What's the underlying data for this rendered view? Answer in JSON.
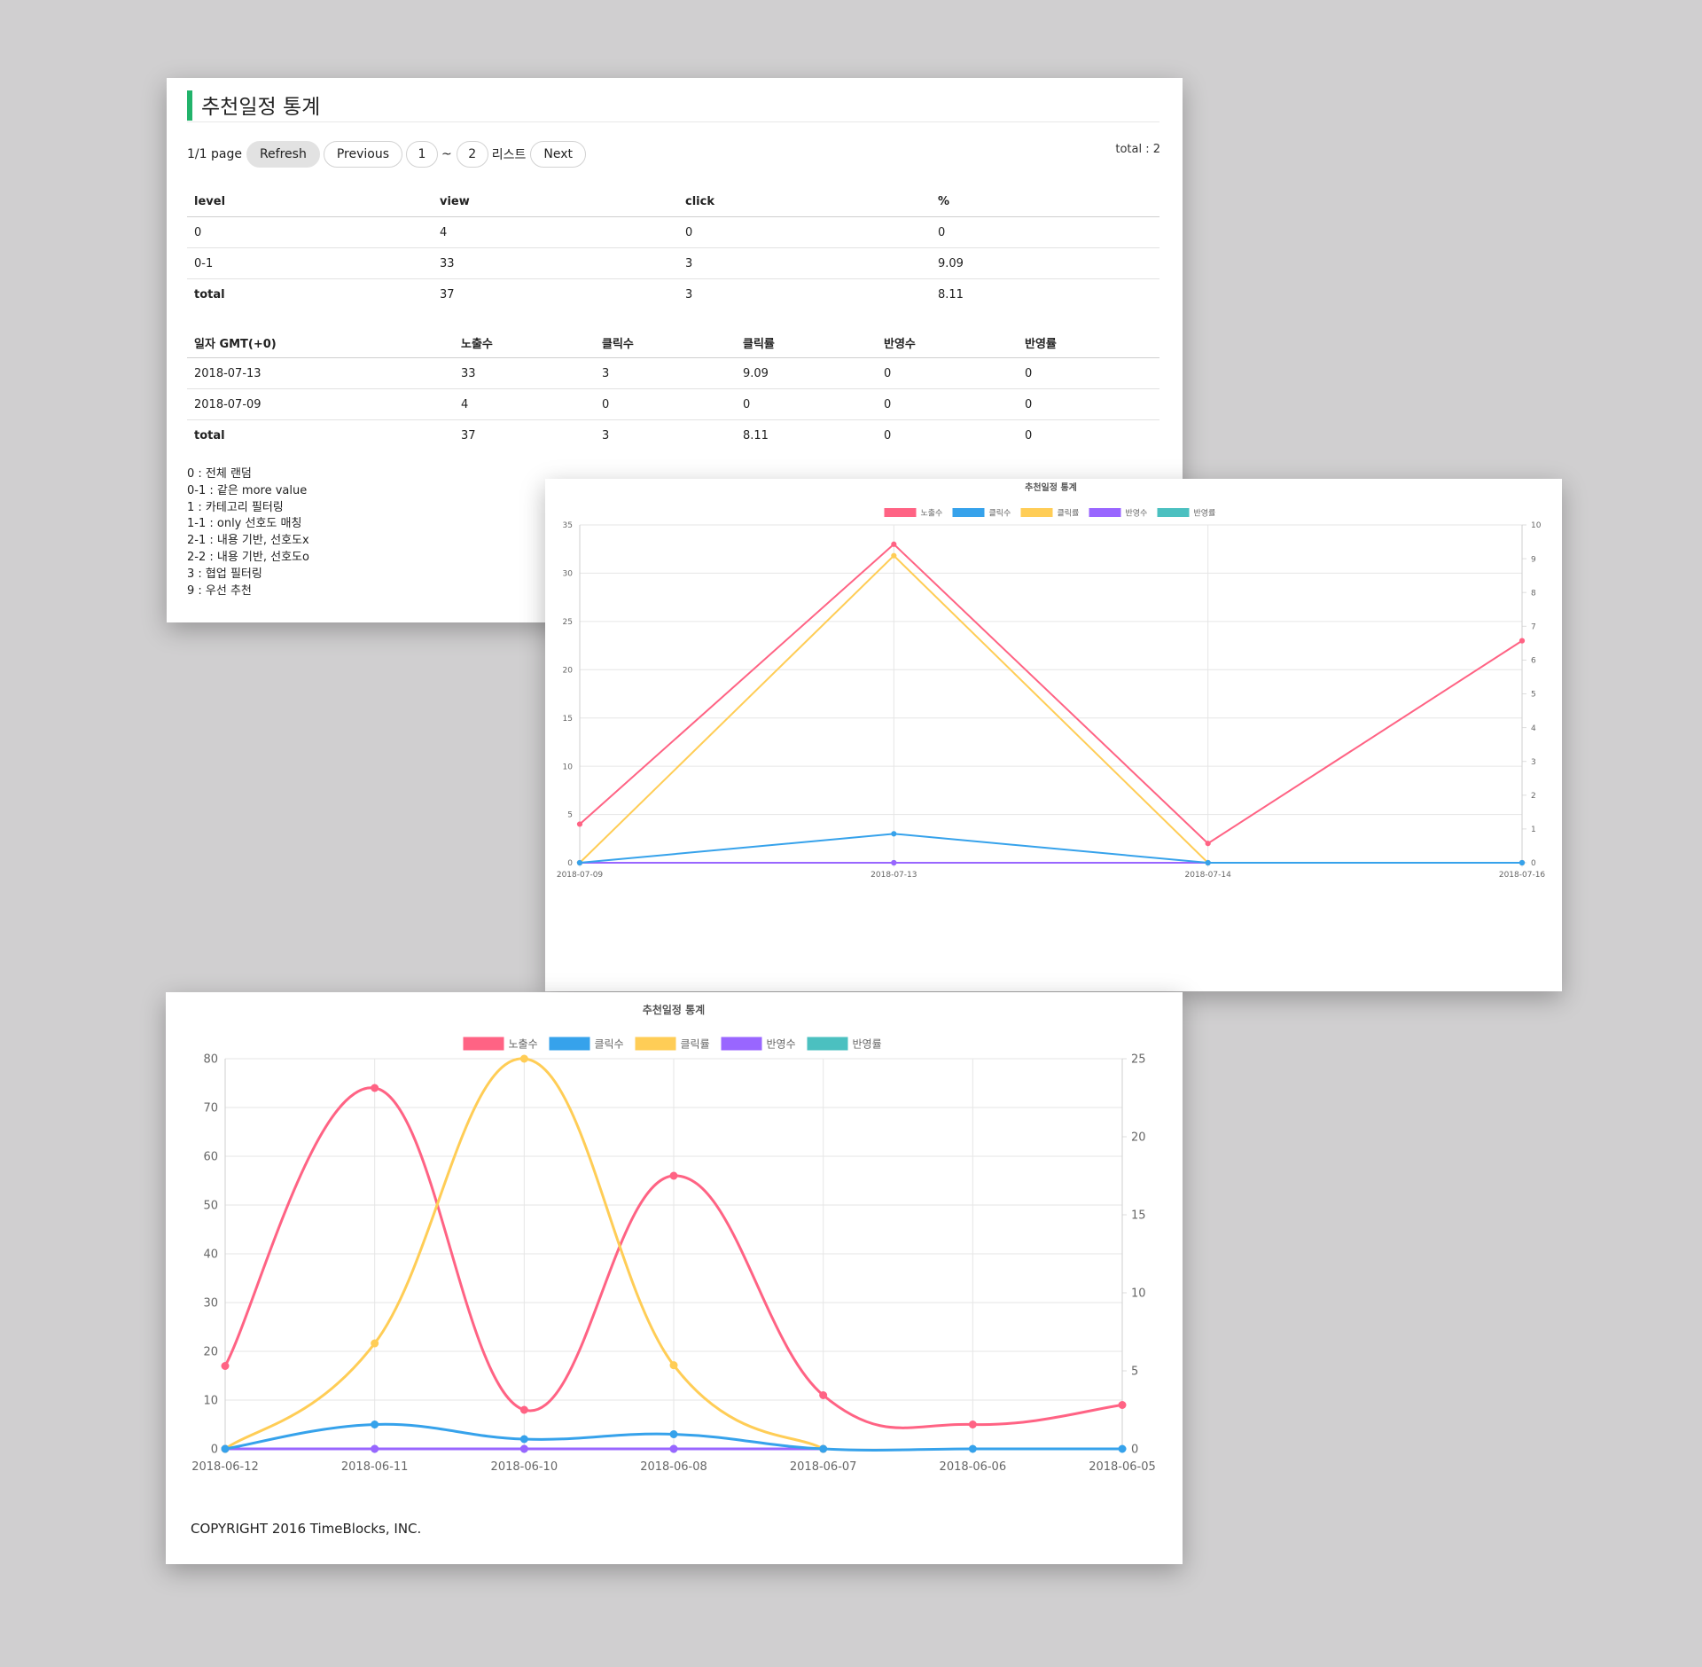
{
  "page": {
    "title": "추천일정 통계",
    "accent_color": "#22b36b"
  },
  "pagination": {
    "page_text": "1/1 page",
    "refresh_label": "Refresh",
    "previous_label": "Previous",
    "page_from": "1",
    "range_sep": "~",
    "page_to": "2",
    "list_label": "리스트",
    "next_label": "Next",
    "total_text": "total : 2"
  },
  "level_table": {
    "headers": [
      "level",
      "view",
      "click",
      "%"
    ],
    "rows": [
      [
        "0",
        "4",
        "0",
        "0"
      ],
      [
        "0-1",
        "33",
        "3",
        "9.09"
      ]
    ],
    "total": [
      "total",
      "37",
      "3",
      "8.11"
    ]
  },
  "daily_table": {
    "headers": [
      "일자 GMT(+0)",
      "노출수",
      "클릭수",
      "클릭률",
      "반영수",
      "반영률"
    ],
    "rows": [
      [
        "2018-07-13",
        "33",
        "3",
        "9.09",
        "0",
        "0"
      ],
      [
        "2018-07-09",
        "4",
        "0",
        "0",
        "0",
        "0"
      ]
    ],
    "total": [
      "total",
      "37",
      "3",
      "8.11",
      "0",
      "0"
    ]
  },
  "level_notes": [
    "0 : 전체 랜덤",
    "0-1 : 같은 more value",
    "1 : 카테고리 필터링",
    "1-1 : only 선호도 매칭",
    "2-1 : 내용 기반, 선호도x",
    "2-2 : 내용 기반, 선호도o",
    "3 : 협업 필터링",
    "9 : 우선 추천"
  ],
  "chart_data": [
    {
      "type": "line",
      "title": "추천일정 통계",
      "x": [
        "2018-07-09",
        "2018-07-13",
        "2018-07-14",
        "2018-07-16"
      ],
      "y_left": {
        "range": [
          0,
          35
        ],
        "ticks": [
          "0",
          "5",
          "10",
          "15",
          "20",
          "25",
          "30",
          "35"
        ]
      },
      "y_right": {
        "range": [
          0,
          10
        ],
        "ticks": [
          "0",
          "1",
          "2",
          "3",
          "4",
          "5",
          "6",
          "7",
          "8",
          "9",
          "10"
        ]
      },
      "grid": true,
      "legend": "top-center",
      "smooth": false,
      "series": [
        {
          "name": "노출수",
          "color": "#ff6384",
          "axis": "left",
          "values": [
            4,
            33,
            2,
            23
          ]
        },
        {
          "name": "클릭수",
          "color": "#36a2eb",
          "axis": "left",
          "values": [
            0,
            3,
            0,
            0
          ]
        },
        {
          "name": "클릭률",
          "color": "#ffcd56",
          "axis": "right",
          "values": [
            0,
            9.09,
            0,
            0
          ]
        },
        {
          "name": "반영수",
          "color": "#9966ff",
          "axis": "left",
          "values": [
            0,
            0,
            0,
            0
          ]
        },
        {
          "name": "반영률",
          "color": "#4bc0c0",
          "axis": "right",
          "values": [
            0,
            0,
            0,
            0
          ]
        }
      ]
    },
    {
      "type": "line",
      "title": "추천일정 통계",
      "x": [
        "2018-06-12",
        "2018-06-11",
        "2018-06-10",
        "2018-06-08",
        "2018-06-07",
        "2018-06-06",
        "2018-06-05"
      ],
      "y_left": {
        "range": [
          0,
          80
        ],
        "ticks": [
          "0",
          "10",
          "20",
          "30",
          "40",
          "50",
          "60",
          "70",
          "80"
        ]
      },
      "y_right": {
        "range": [
          0,
          25
        ],
        "ticks": [
          "0",
          "5",
          "10",
          "15",
          "20",
          "25"
        ]
      },
      "grid": true,
      "legend": "top-center",
      "smooth": true,
      "series": [
        {
          "name": "노출수",
          "color": "#ff6384",
          "axis": "left",
          "values": [
            17,
            74,
            8,
            56,
            11,
            5,
            9
          ]
        },
        {
          "name": "클릭수",
          "color": "#36a2eb",
          "axis": "left",
          "values": [
            0,
            5,
            2,
            3,
            0,
            0,
            0
          ]
        },
        {
          "name": "클릭률",
          "color": "#ffcd56",
          "axis": "right",
          "values": [
            0,
            6.76,
            25,
            5.36,
            0,
            null,
            null
          ]
        },
        {
          "name": "반영수",
          "color": "#9966ff",
          "axis": "left",
          "values": [
            0,
            0,
            0,
            0,
            0,
            null,
            null
          ]
        },
        {
          "name": "반영률",
          "color": "#4bc0c0",
          "axis": "right",
          "values": [
            0,
            0,
            0,
            0,
            0,
            null,
            null
          ]
        }
      ]
    }
  ],
  "footer": {
    "copyright": "COPYRIGHT 2016 TimeBlocks, INC."
  }
}
